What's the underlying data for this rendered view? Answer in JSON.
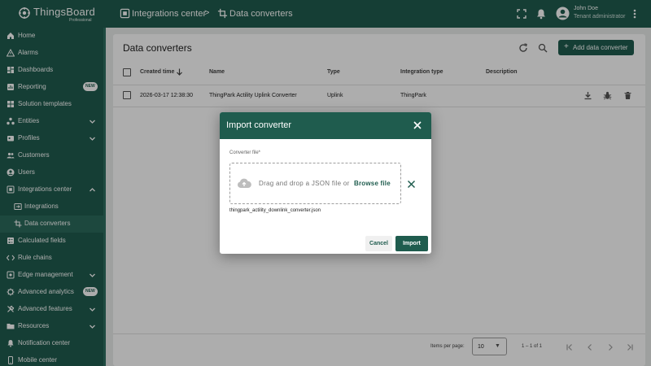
{
  "app": {
    "brand": "ThingsBoard",
    "edition": "Professional"
  },
  "topbar": {
    "breadcrumbs": [
      {
        "label": "Integrations center",
        "icon": "integrations-icon"
      },
      {
        "label": "Data converters",
        "icon": "transform-icon"
      }
    ],
    "separator": ">",
    "user": {
      "name": "John Doe",
      "role": "Tenant administrator"
    }
  },
  "sidebar": {
    "items": [
      {
        "label": "Home",
        "icon": "home-icon"
      },
      {
        "label": "Alarms",
        "icon": "warning-icon"
      },
      {
        "label": "Dashboards",
        "icon": "dashboard-icon"
      },
      {
        "label": "Reporting",
        "icon": "report-icon",
        "badge": "NEW"
      },
      {
        "label": "Solution templates",
        "icon": "grid-icon"
      },
      {
        "label": "Entities",
        "icon": "entities-icon"
      },
      {
        "label": "Profiles",
        "icon": "profiles-icon"
      },
      {
        "label": "Customers",
        "icon": "customers-icon"
      },
      {
        "label": "Users",
        "icon": "user-icon"
      },
      {
        "label": "Integrations center",
        "icon": "integrations-icon"
      },
      {
        "label": "Integrations",
        "icon": "integration-icon"
      },
      {
        "label": "Data converters",
        "icon": "transform-icon"
      },
      {
        "label": "Calculated fields",
        "icon": "calc-icon"
      },
      {
        "label": "Rule chains",
        "icon": "code-icon"
      },
      {
        "label": "Edge management",
        "icon": "edge-icon"
      },
      {
        "label": "Advanced analytics",
        "icon": "analytics-icon",
        "badge": "NEW"
      },
      {
        "label": "Advanced features",
        "icon": "tools-icon"
      },
      {
        "label": "Resources",
        "icon": "folder-icon"
      },
      {
        "label": "Notification center",
        "icon": "bell-icon"
      },
      {
        "label": "Mobile center",
        "icon": "mobile-icon"
      }
    ]
  },
  "main": {
    "title": "Data converters",
    "add_button": "Add data converter",
    "columns": [
      "Created time",
      "Name",
      "Type",
      "Integration type",
      "Description"
    ],
    "rows": [
      {
        "created": "2026-03-17 12:38:30",
        "name": "ThingPark Actility Uplink Converter",
        "type": "Uplink",
        "integration_type": "ThingPark",
        "description": ""
      }
    ],
    "pagination": {
      "items_per_page_label": "Items per page:",
      "items_per_page": "10",
      "range": "1 – 1 of 1"
    }
  },
  "dialog": {
    "title": "Import converter",
    "field_label": "Converter file*",
    "drop_text": "Drag and drop a JSON file or",
    "browse_label": "Browse file",
    "file_name": "thingpark_actility_downlink_converter.json",
    "cancel_label": "Cancel",
    "import_label": "Import"
  },
  "colors": {
    "primary": "#1f5c4e",
    "overlay": "rgba(0,0,0,0.32)"
  }
}
